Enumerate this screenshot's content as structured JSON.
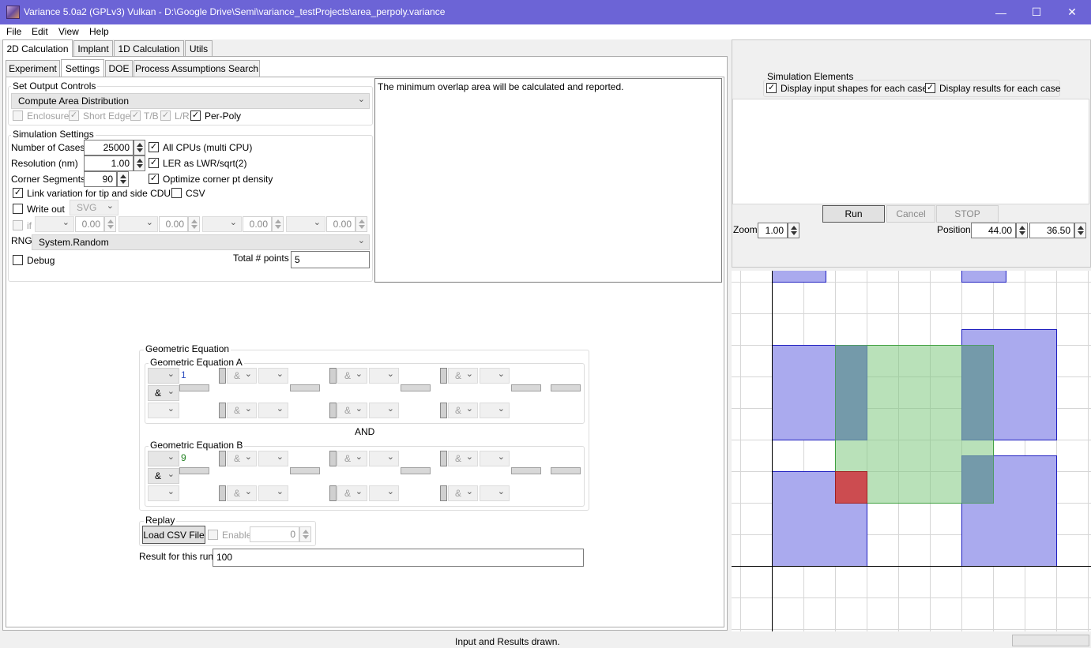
{
  "window": {
    "title": "Variance 5.0a2 (GPLv3) Vulkan - D:\\Google Drive\\Semi\\variance_testProjects\\area_perpoly.variance",
    "min": "—",
    "max": "☐",
    "close": "✕"
  },
  "menu": [
    "File",
    "Edit",
    "View",
    "Help"
  ],
  "main_tabs": [
    "2D Calculation",
    "Implant",
    "1D Calculation",
    "Utils"
  ],
  "sub_tabs": [
    "Experiment",
    "Settings",
    "DOE",
    "Process Assumptions Search"
  ],
  "output": {
    "group_label": "Set Output Controls",
    "mode": "Compute Area Distribution",
    "checks": [
      {
        "label": "Enclosure",
        "checked": false
      },
      {
        "label": "Short Edge",
        "checked": true
      },
      {
        "label": "T/B",
        "checked": true
      },
      {
        "label": "L/R",
        "checked": true
      },
      {
        "label": "Per-Poly",
        "checked": true
      }
    ]
  },
  "description": "The minimum overlap area will be calculated and reported.",
  "sim": {
    "group_label": "Simulation Settings",
    "cases_label": "Number of Cases",
    "cases": "25000",
    "res_label": "Resolution (nm)",
    "res": "1.00",
    "corner_label": "Corner Segments",
    "corner": "90",
    "allcpu": "All CPUs (multi CPU)",
    "ler": "LER as LWR/sqrt(2)",
    "optimize": "Optimize corner pt density",
    "link": "Link variation for tip and side CDU",
    "csv": "CSV",
    "writeout": "Write out",
    "format": "SVG",
    "if": "if",
    "if_vals": [
      "0.00",
      "0.00",
      "0.00",
      "0.00"
    ],
    "rng_label": "RNG",
    "rng": "System.Random",
    "debug": "Debug",
    "total_label": "Total # points",
    "total": "5"
  },
  "geo": {
    "group_label": "Geometric Equation",
    "a_label": "Geometric Equation A",
    "a_num": "1",
    "and": "AND",
    "b_label": "Geometric Equation B",
    "b_num": "9",
    "amp": "&"
  },
  "replay": {
    "group_label": "Replay",
    "load": "Load CSV File",
    "enable": "Enable",
    "value": "0"
  },
  "result": {
    "label": "Result for this run",
    "value": "100"
  },
  "simelems": {
    "group_label": "Simulation Elements",
    "input": "Display input shapes for each case",
    "results": "Display results for each case"
  },
  "controls": {
    "run": "Run",
    "cancel": "Cancel",
    "stop": "STOP",
    "zoom_label": "Zoom",
    "zoom": "1.00",
    "pos_label": "Position",
    "pos_x": "44.00",
    "pos_y": "36.50"
  },
  "status": "Input and Results drawn.",
  "colors": {
    "titlebar": "#6c64d6",
    "shape_blue": "#aaaaee",
    "overlap_green": "#b4dcb0",
    "result_red": "#cc4c50"
  }
}
